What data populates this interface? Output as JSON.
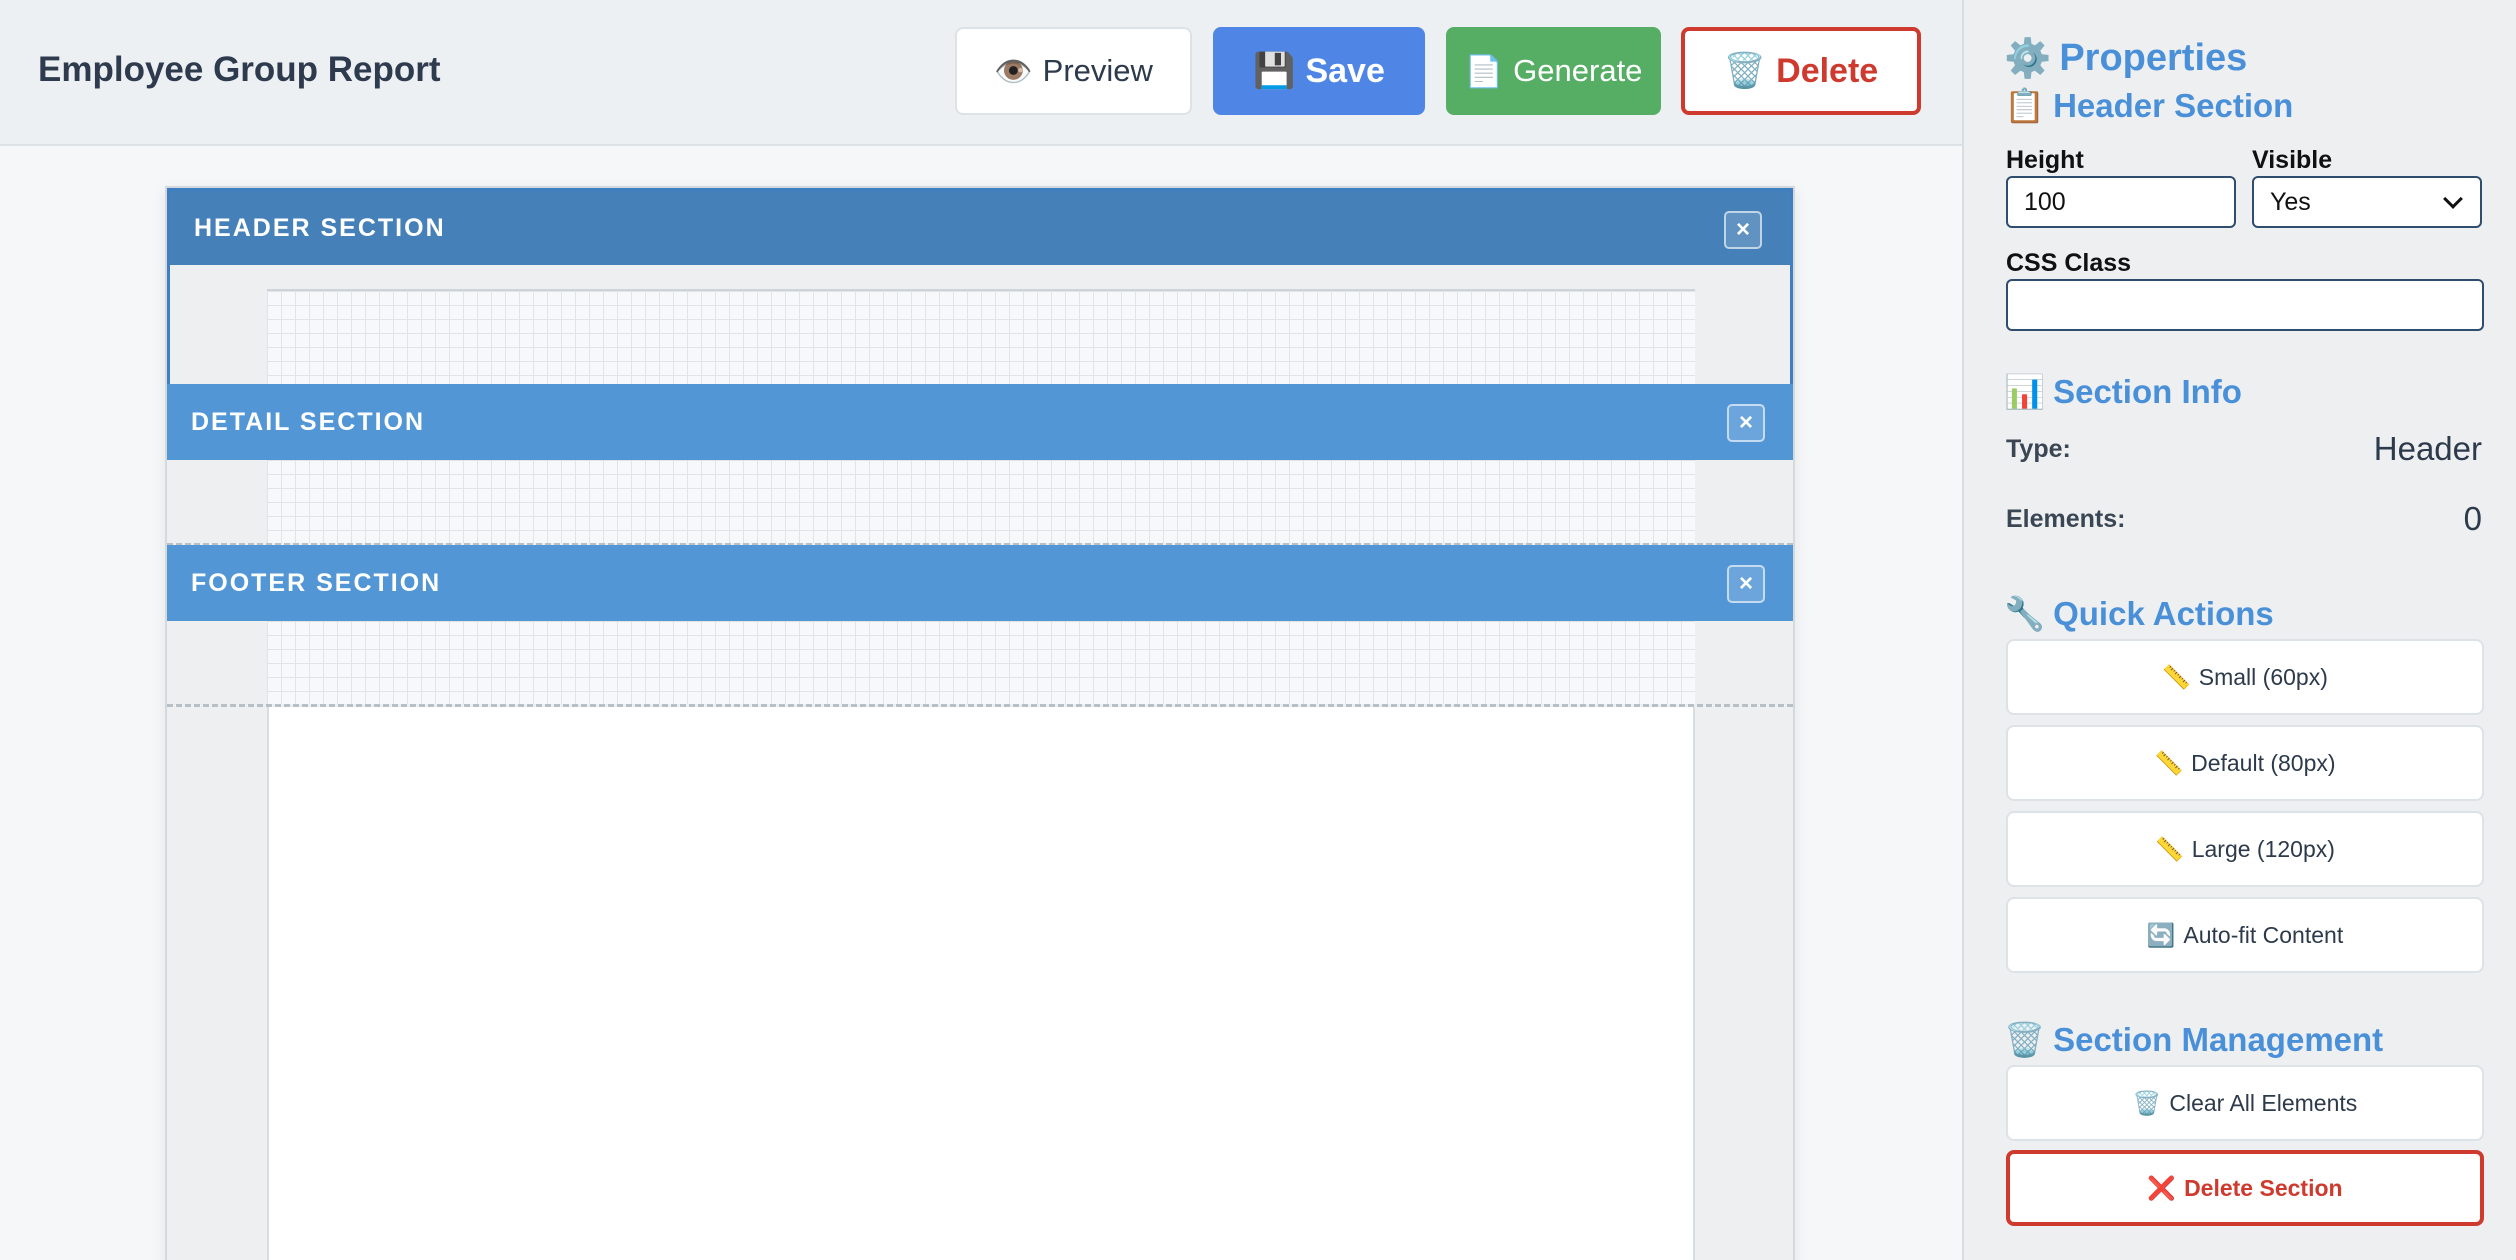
{
  "toolbar": {
    "title": "Employee Group Report",
    "preview_label": "Preview",
    "preview_icon": "👁️",
    "save_label": "Save",
    "save_icon": "💾",
    "generate_label": "Generate",
    "generate_icon": "📄",
    "delete_label": "Delete",
    "delete_icon": "🗑️"
  },
  "sections": [
    {
      "title": "HEADER SECTION",
      "close": "×"
    },
    {
      "title": "DETAIL SECTION",
      "close": "×"
    },
    {
      "title": "FOOTER SECTION",
      "close": "×"
    }
  ],
  "panel": {
    "title": "Properties",
    "title_icon": "⚙️",
    "selected_section": "Header Section",
    "selected_icon": "📋",
    "height_label": "Height",
    "height_value": "100",
    "visible_label": "Visible",
    "visible_value": "Yes",
    "css_label": "CSS Class",
    "css_value": "",
    "info_title": "Section Info",
    "info_icon": "📊",
    "type_label": "Type:",
    "type_value": "Header",
    "elements_label": "Elements:",
    "elements_value": "0",
    "qa_title": "Quick Actions",
    "qa_icon": "🔧",
    "qa_small": "Small (60px)",
    "qa_default": "Default (80px)",
    "qa_large": "Large (120px)",
    "qa_autofit": "Auto-fit Content",
    "qa_ruler_icon": "📏",
    "qa_autofit_icon": "🔄",
    "mgmt_title": "Section Management",
    "mgmt_icon": "🗑️",
    "clear_label": "Clear All Elements",
    "clear_icon": "🗑️",
    "delete_section_label": "Delete Section",
    "delete_section_icon": "❌"
  },
  "colors": {
    "accent": "#4a90d9",
    "save": "#4f86e6",
    "generate": "#56ad64",
    "danger": "#cf3a2f",
    "section_bar": "#5396d6"
  }
}
